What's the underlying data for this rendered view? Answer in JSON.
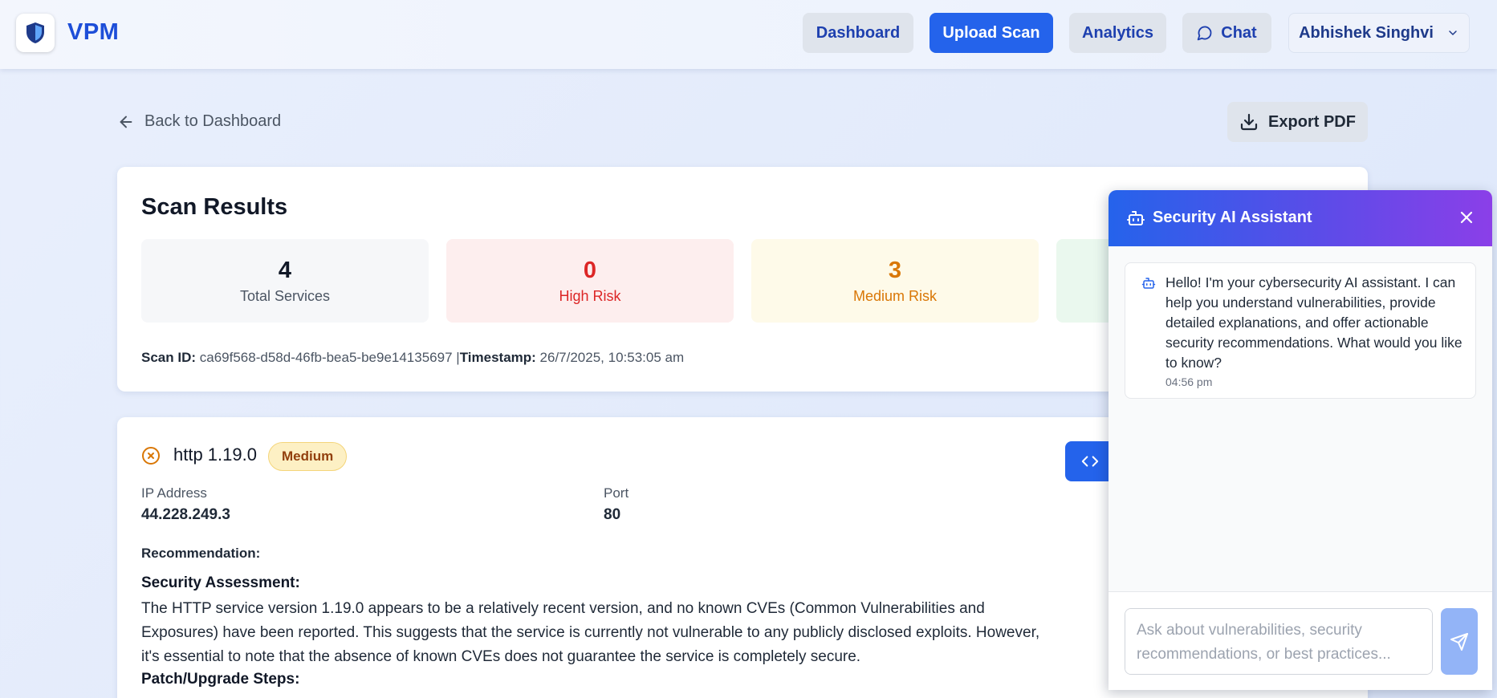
{
  "header": {
    "brand": "VPM",
    "nav": {
      "dashboard": "Dashboard",
      "upload_scan": "Upload Scan",
      "analytics": "Analytics",
      "chat": "Chat"
    },
    "user_name": "Abhishek Singhvi"
  },
  "toolbar": {
    "back_label": "Back to Dashboard",
    "export_label": "Export PDF"
  },
  "results": {
    "title": "Scan Results",
    "stats": {
      "total": {
        "value": "4",
        "label": "Total Services"
      },
      "high": {
        "value": "0",
        "label": "High Risk"
      },
      "medium": {
        "value": "3",
        "label": "Medium Risk"
      }
    },
    "scan_id_label": "Scan ID:",
    "scan_id": "ca69f568-d58d-46fb-bea5-be9e14135697",
    "separator": "|",
    "timestamp_label": "Timestamp:",
    "timestamp": "26/7/2025, 10:53:05 am"
  },
  "service": {
    "name": "http 1.19.0",
    "severity": "Medium",
    "ip_label": "IP Address",
    "ip": "44.228.249.3",
    "port_label": "Port",
    "port": "80",
    "recommendation_label": "Recommendation:",
    "assessment_heading": "Security Assessment:",
    "assessment_text": "The HTTP service version 1.19.0 appears to be a relatively recent version, and no known CVEs (Common Vulnerabilities and Exposures) have been reported. This suggests that the service is currently not vulnerable to any publicly disclosed exploits. However, it's essential to note that the absence of known CVEs does not guarantee the service is completely secure.",
    "patch_heading": "Patch/Upgrade Steps:"
  },
  "chat": {
    "title": "Security AI Assistant",
    "message": "Hello! I'm your cybersecurity AI assistant. I can help you understand vulnerabilities, provide detailed explanations, and offer actionable security recommendations. What would you like to know?",
    "time": "04:56 pm",
    "input_value": "",
    "placeholder": "Ask about vulnerabilities, security recommendations, or best practices..."
  },
  "colors": {
    "primary": "#2463eb",
    "brand": "#1d4ed8",
    "high_risk": "#dc2626",
    "medium_risk": "#d97706",
    "chat_gradient_start": "#2563eb",
    "chat_gradient_end": "#8b3fe8"
  },
  "icons": {
    "logo": "shield-logo-icon",
    "chat": "message-circle-icon",
    "user_menu": "chevron-down-icon",
    "back": "arrow-left-icon",
    "export": "download-icon",
    "service_status": "x-circle-icon",
    "code": "code-icon",
    "bot": "bot-icon",
    "close": "close-icon",
    "send": "send-icon"
  }
}
